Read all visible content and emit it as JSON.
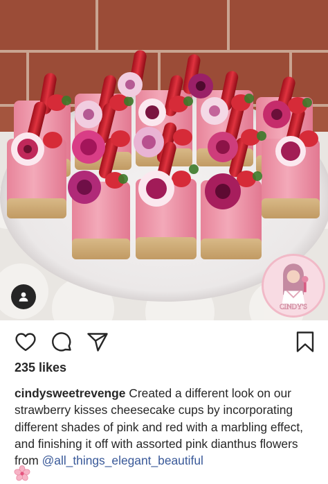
{
  "post": {
    "likes_text": "235 likes",
    "caption": {
      "username": "cindysweetrevenge",
      "text": " Created a different look on our strawberry kisses cheesecake cups by incorporating different shades of pink and red with a marbling effect, and finishing it off with assorted pink dianthus flowers from ",
      "mention": "@all_things_elegant_beautiful",
      "emoji": "cherry-blossom"
    },
    "watermark_text": "CINDY'S"
  },
  "icons": {
    "user_tag": "person-icon",
    "like": "heart-icon",
    "comment": "comment-icon",
    "share": "paper-plane-icon",
    "save": "bookmark-icon"
  },
  "colors": {
    "text": "#262626",
    "mention": "#385898",
    "cup_pink": "#ec7f97",
    "brick": "#a5553f"
  }
}
